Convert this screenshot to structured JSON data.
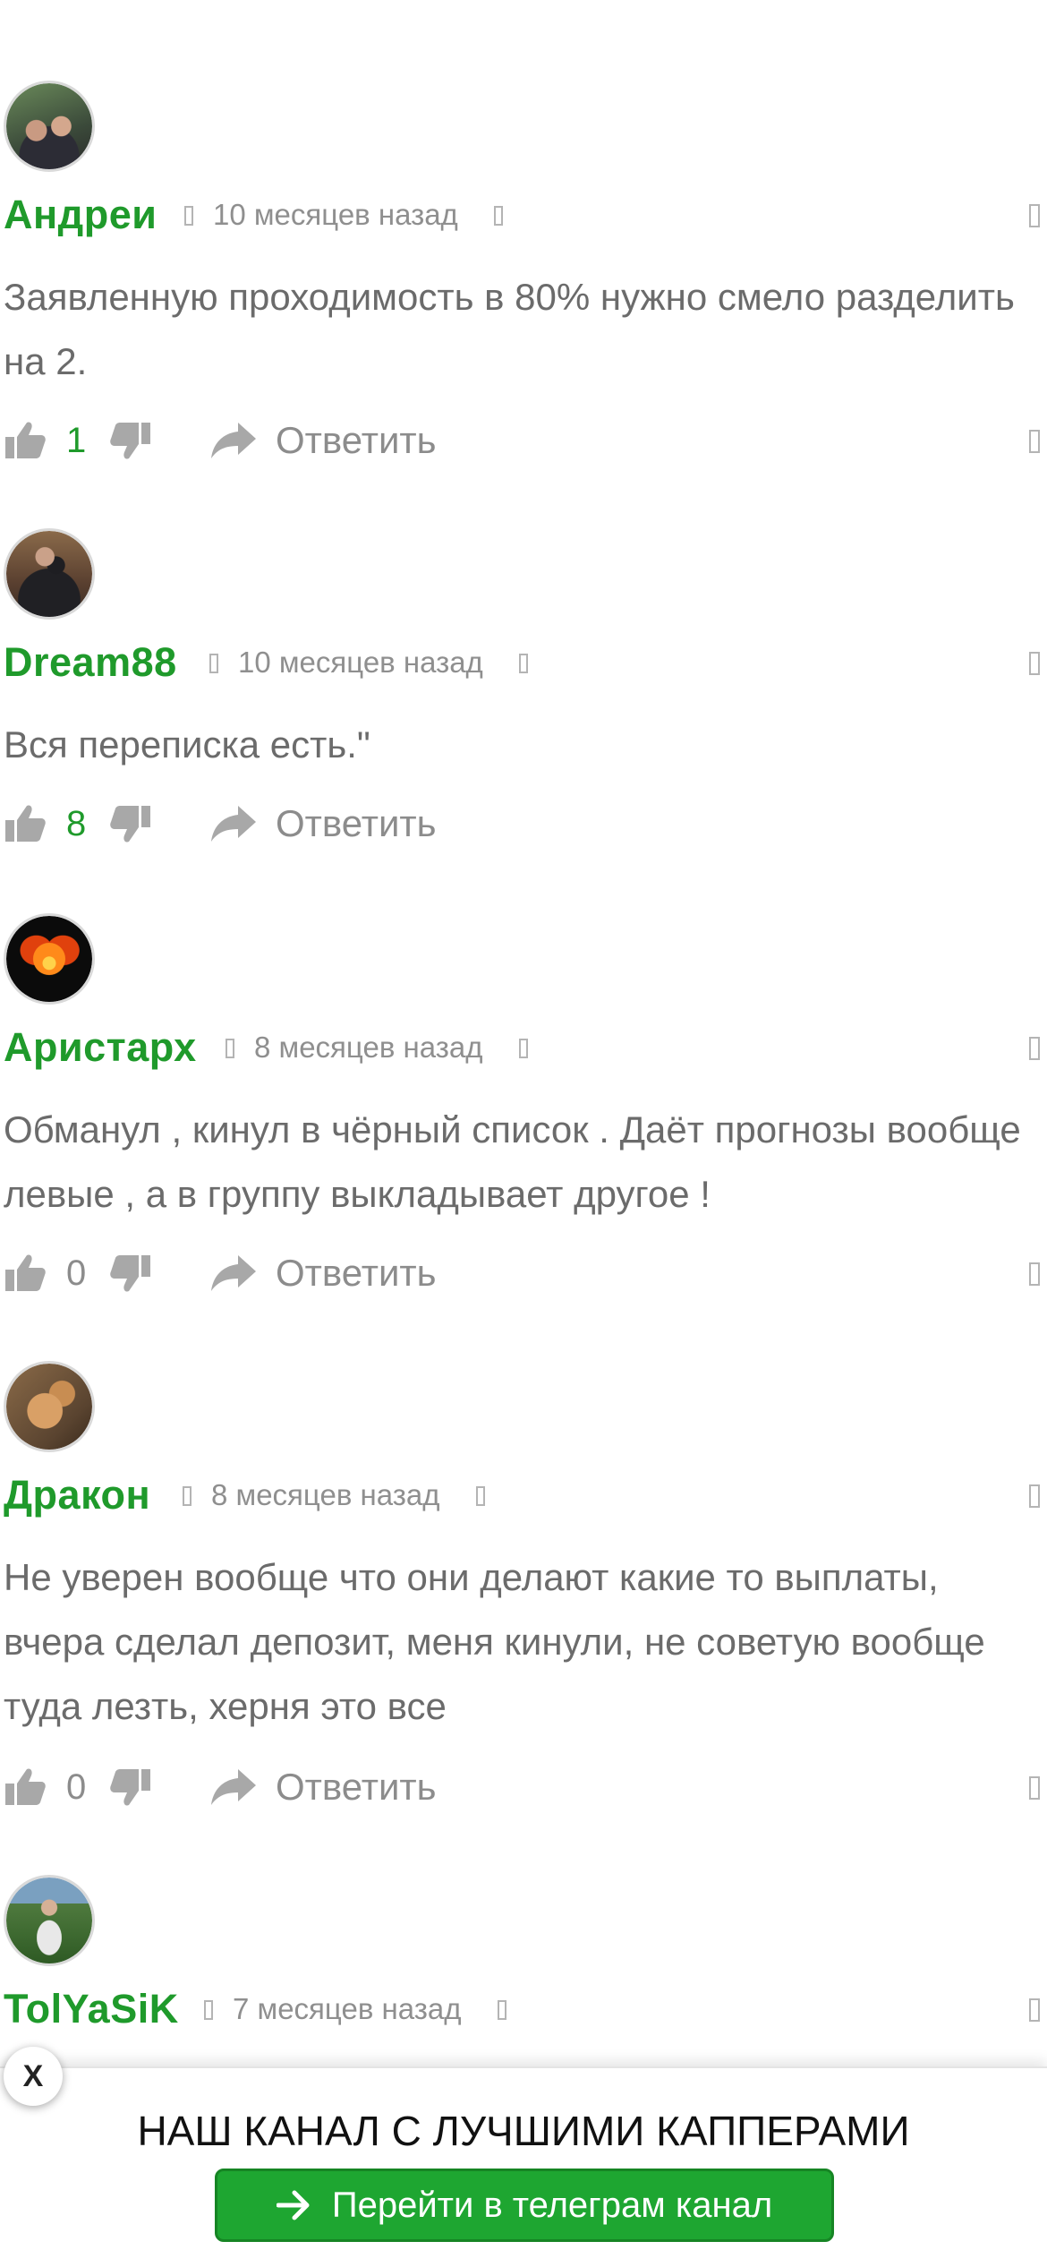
{
  "colors": {
    "author": "#1f9a2b",
    "positive_count": "#1f9a2b",
    "neutral_count": "#8c8c8c",
    "icon": "#a8a8a8",
    "banner_button": "#1ea631"
  },
  "comments": [
    {
      "author": "Андреи",
      "time": "10 месяцев назад",
      "text": "Заявленную проходимость в 80% нужно смело разделить на 2.",
      "votes": "1",
      "reply_label": "Ответить"
    },
    {
      "author": "Dream88",
      "time": "10 месяцев назад",
      "text": "Вся переписка есть.\"",
      "votes": "8",
      "reply_label": "Ответить"
    },
    {
      "author": "Аристарх",
      "time": "8 месяцев назад",
      "text": "Обманул , кинул в чёрный список . Даёт прогнозы вообще левые , а в группу выкладывает другое !",
      "votes": "0",
      "reply_label": "Ответить"
    },
    {
      "author": "Дракон",
      "time": "8 месяцев назад",
      "text": "Не уверен вообще что они делают какие то выплаты, вчера сделал депозит, меня кинули, не советую вообще туда лезть, херня это все",
      "votes": "0",
      "reply_label": "Ответить"
    },
    {
      "author": "TolYaSiK",
      "time": "7 месяцев назад"
    }
  ],
  "icons": {
    "like": "thumbs-up-icon",
    "dislike": "thumbs-down-icon",
    "reply": "reply-arrow-icon",
    "banner_arrow": "arrow-right-icon"
  },
  "banner": {
    "close_label": "X",
    "title": "НАШ КАНАЛ С ЛУЧШИМИ КАППЕРАМИ",
    "button_label": "Перейти в телеграм канал"
  }
}
